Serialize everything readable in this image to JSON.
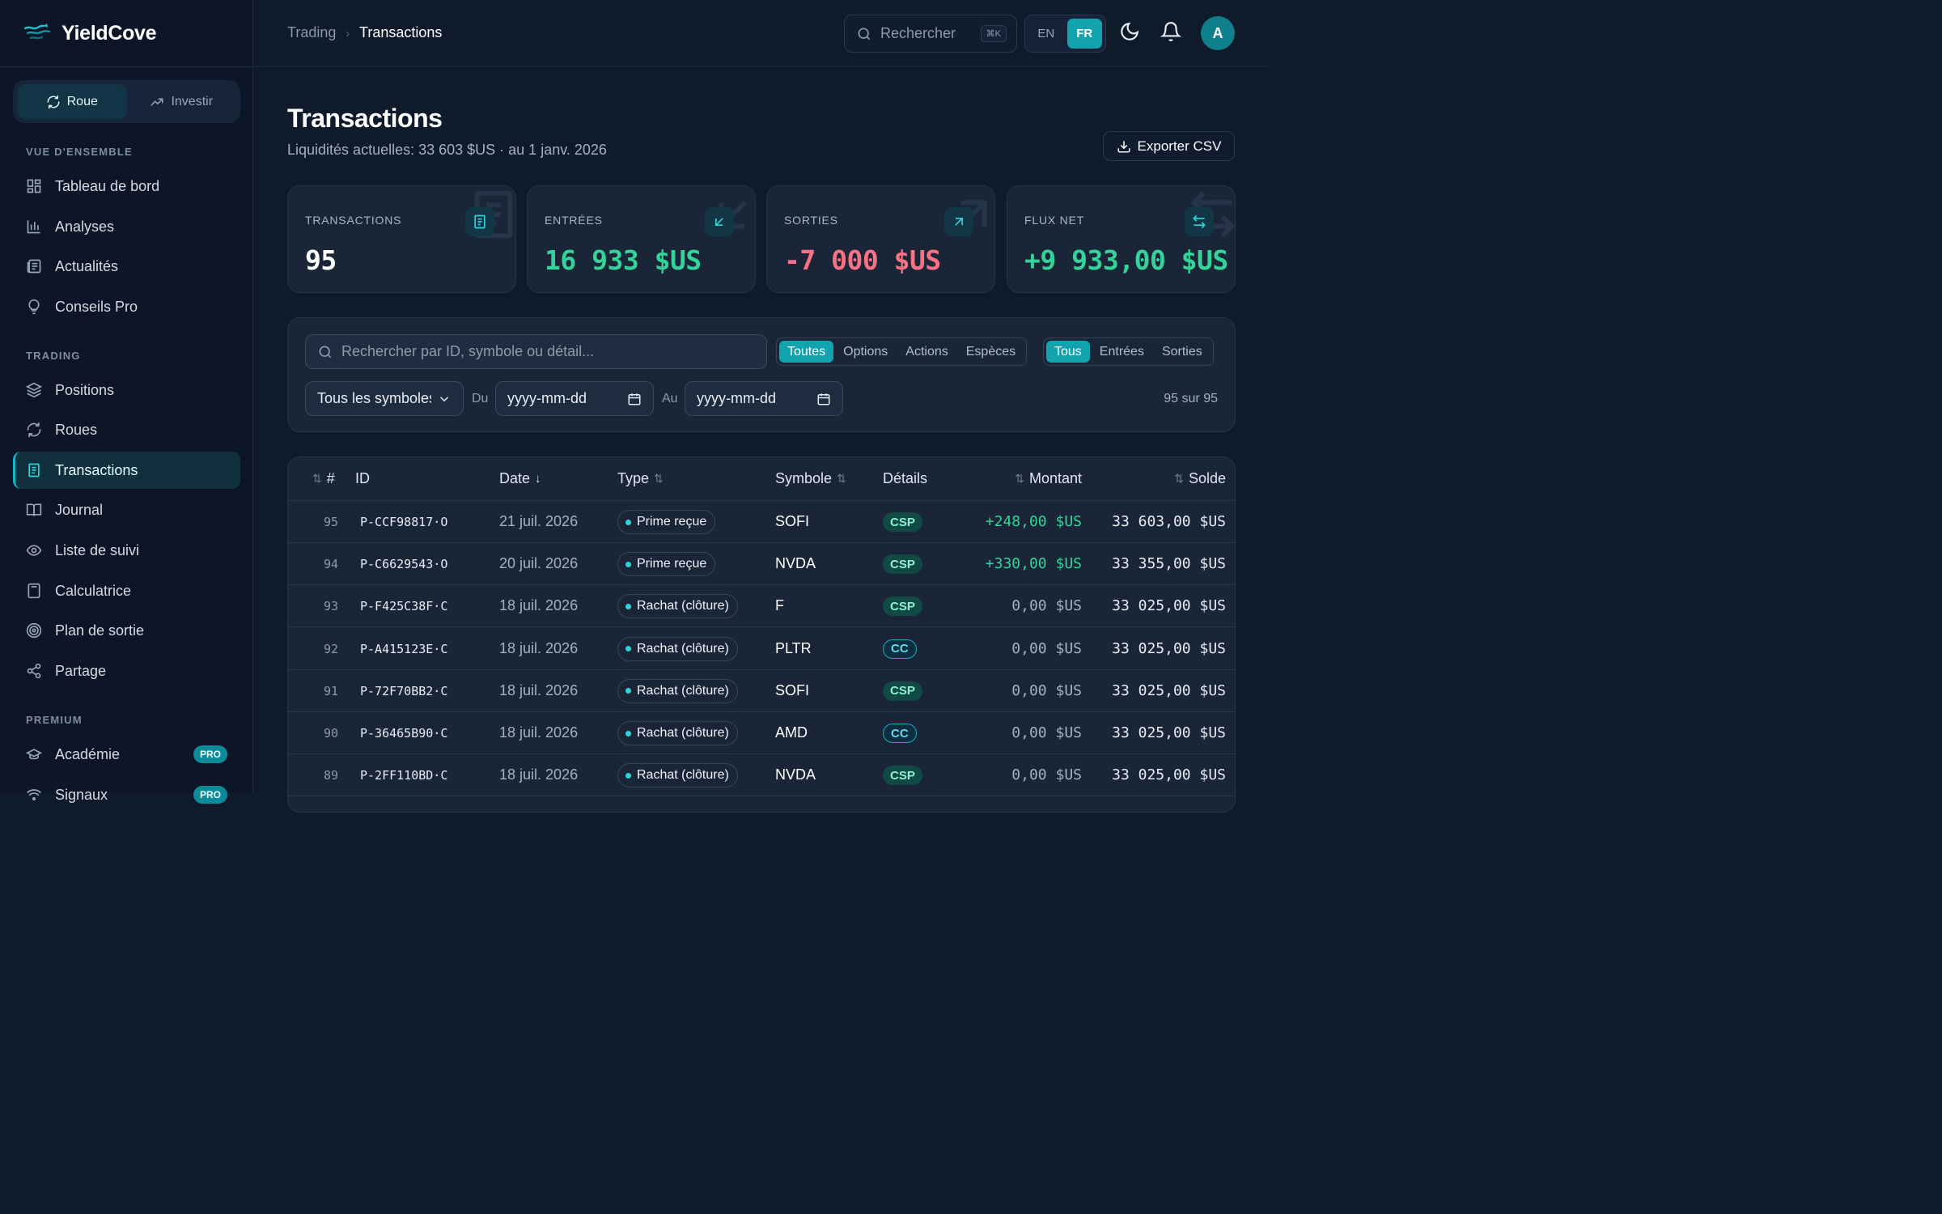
{
  "app": {
    "name": "YieldCove"
  },
  "mode": {
    "wheel": "Roue",
    "invest": "Investir"
  },
  "sidebar": {
    "overview_label": "VUE D'ENSEMBLE",
    "overview": [
      {
        "label": "Tableau de bord",
        "icon": "dashboard-icon"
      },
      {
        "label": "Analyses",
        "icon": "bar-chart-icon"
      },
      {
        "label": "Actualités",
        "icon": "newspaper-icon"
      },
      {
        "label": "Conseils Pro",
        "icon": "lightbulb-icon"
      }
    ],
    "trading_label": "TRADING",
    "trading": [
      {
        "label": "Positions",
        "icon": "layers-icon"
      },
      {
        "label": "Roues",
        "icon": "refresh-icon"
      },
      {
        "label": "Transactions",
        "icon": "receipt-icon"
      },
      {
        "label": "Journal",
        "icon": "book-icon"
      },
      {
        "label": "Liste de suivi",
        "icon": "eye-icon"
      },
      {
        "label": "Calculatrice",
        "icon": "calculator-icon"
      },
      {
        "label": "Plan de sortie",
        "icon": "target-icon"
      },
      {
        "label": "Partage",
        "icon": "share-icon"
      }
    ],
    "premium_label": "PREMIUM",
    "premium": [
      {
        "label": "Académie",
        "badge": "PRO",
        "icon": "graduation-cap-icon"
      },
      {
        "label": "Signaux",
        "badge": "PRO",
        "icon": "signal-icon"
      }
    ],
    "active": "Transactions"
  },
  "topbar": {
    "breadcrumb": [
      "Trading",
      "Transactions"
    ],
    "search_placeholder": "Rechercher",
    "shortcut": "⌘K",
    "lang": {
      "en": "EN",
      "fr": "FR",
      "active": "FR"
    },
    "avatar": "A"
  },
  "page": {
    "title": "Transactions",
    "subtitle": "Liquidités actuelles: 33 603 $US · au 1 janv. 2026",
    "export": "Exporter CSV"
  },
  "stats": [
    {
      "label": "TRANSACTIONS",
      "value": "95",
      "tone": "neutral"
    },
    {
      "label": "ENTRÉES",
      "value": "16 933 $US",
      "tone": "pos"
    },
    {
      "label": "SORTIES",
      "value": "-7 000 $US",
      "tone": "neg"
    },
    {
      "label": "FLUX NET",
      "value": "+9 933,00 $US",
      "tone": "pos"
    }
  ],
  "filters": {
    "search_placeholder": "Rechercher par ID, symbole ou détail...",
    "kind": [
      "Toutes",
      "Options",
      "Actions",
      "Espèces"
    ],
    "kind_active": "Toutes",
    "direction": [
      "Tous",
      "Entrées",
      "Sorties"
    ],
    "direction_active": "Tous",
    "symbol": "Tous les symboles",
    "from_label": "Du",
    "from_value": "yyyy-mm-dd",
    "to_label": "Au",
    "to_value": "yyyy-mm-dd",
    "count": "95 sur 95"
  },
  "table": {
    "headers": {
      "num": "#",
      "id": "ID",
      "date": "Date",
      "type": "Type",
      "symbol": "Symbole",
      "details": "Détails",
      "amount": "Montant",
      "balance": "Solde"
    },
    "rows": [
      {
        "num": "95",
        "id": "P-CCF98817·O",
        "date": "21 juil. 2026",
        "type": "Prime reçue",
        "symbol": "SOFI",
        "tag": "CSP",
        "amount": "+248,00 $US",
        "balance": "33 603,00 $US"
      },
      {
        "num": "94",
        "id": "P-C6629543·O",
        "date": "20 juil. 2026",
        "type": "Prime reçue",
        "symbol": "NVDA",
        "tag": "CSP",
        "amount": "+330,00 $US",
        "balance": "33 355,00 $US"
      },
      {
        "num": "93",
        "id": "P-F425C38F·C",
        "date": "18 juil. 2026",
        "type": "Rachat (clôture)",
        "symbol": "F",
        "tag": "CSP",
        "amount": "0,00 $US",
        "balance": "33 025,00 $US"
      },
      {
        "num": "92",
        "id": "P-A415123E·C",
        "date": "18 juil. 2026",
        "type": "Rachat (clôture)",
        "symbol": "PLTR",
        "tag": "CC",
        "amount": "0,00 $US",
        "balance": "33 025,00 $US"
      },
      {
        "num": "91",
        "id": "P-72F70BB2·C",
        "date": "18 juil. 2026",
        "type": "Rachat (clôture)",
        "symbol": "SOFI",
        "tag": "CSP",
        "amount": "0,00 $US",
        "balance": "33 025,00 $US"
      },
      {
        "num": "90",
        "id": "P-36465B90·C",
        "date": "18 juil. 2026",
        "type": "Rachat (clôture)",
        "symbol": "AMD",
        "tag": "CC",
        "amount": "0,00 $US",
        "balance": "33 025,00 $US"
      },
      {
        "num": "89",
        "id": "P-2FF110BD·C",
        "date": "18 juil. 2026",
        "type": "Rachat (clôture)",
        "symbol": "NVDA",
        "tag": "CSP",
        "amount": "0,00 $US",
        "balance": "33 025,00 $US"
      }
    ]
  }
}
